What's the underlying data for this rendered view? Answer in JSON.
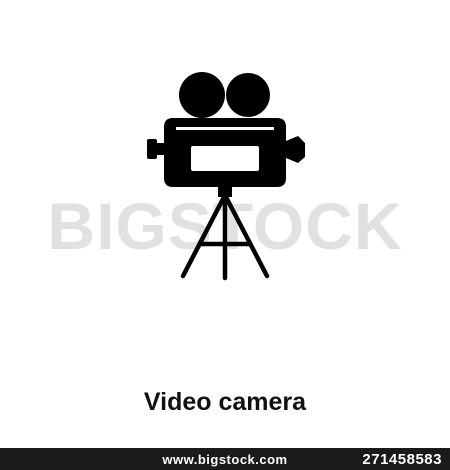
{
  "icon": {
    "name": "video-camera-icon",
    "color": "#000000"
  },
  "watermark": {
    "text": "BIGSTOCK"
  },
  "title": {
    "text": "Video camera"
  },
  "footer": {
    "url": "www.bigstock.com",
    "image_id": "271458583",
    "background": "#1a1a1a"
  }
}
